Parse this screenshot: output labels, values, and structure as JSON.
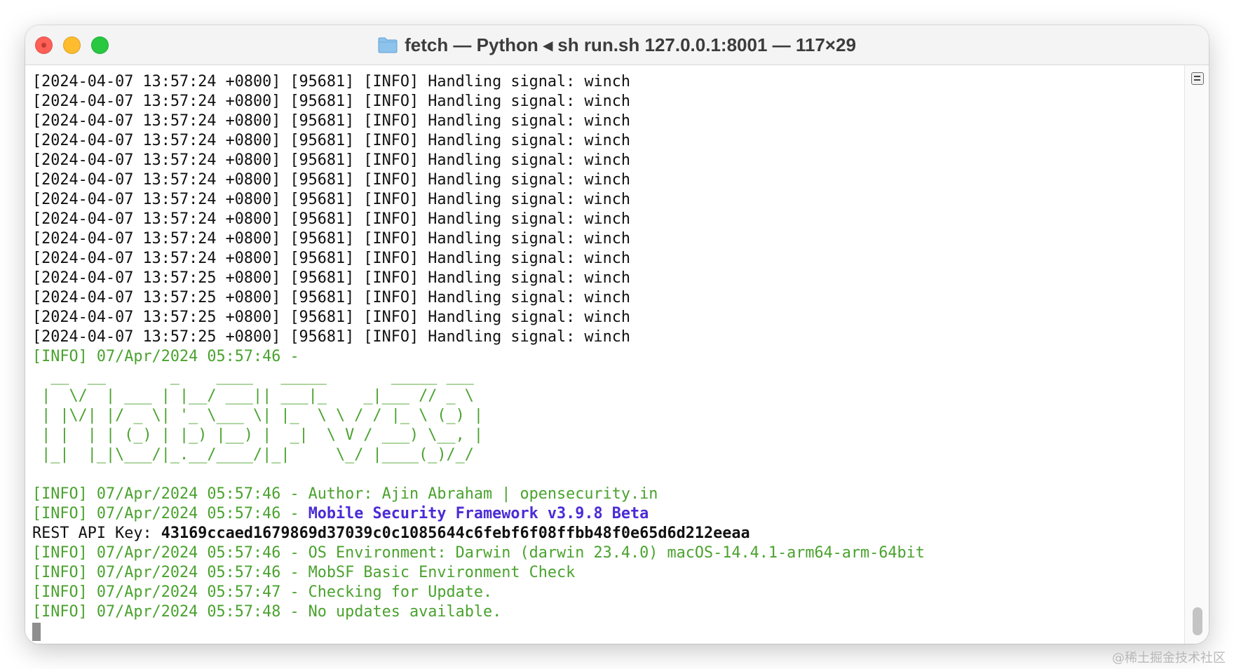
{
  "window": {
    "title": "fetch — Python ◂ sh run.sh 127.0.0.1:8001 — 117×29"
  },
  "log_lines": [
    "[2024-04-07 13:57:24 +0800] [95681] [INFO] Handling signal: winch",
    "[2024-04-07 13:57:24 +0800] [95681] [INFO] Handling signal: winch",
    "[2024-04-07 13:57:24 +0800] [95681] [INFO] Handling signal: winch",
    "[2024-04-07 13:57:24 +0800] [95681] [INFO] Handling signal: winch",
    "[2024-04-07 13:57:24 +0800] [95681] [INFO] Handling signal: winch",
    "[2024-04-07 13:57:24 +0800] [95681] [INFO] Handling signal: winch",
    "[2024-04-07 13:57:24 +0800] [95681] [INFO] Handling signal: winch",
    "[2024-04-07 13:57:24 +0800] [95681] [INFO] Handling signal: winch",
    "[2024-04-07 13:57:24 +0800] [95681] [INFO] Handling signal: winch",
    "[2024-04-07 13:57:24 +0800] [95681] [INFO] Handling signal: winch",
    "[2024-04-07 13:57:25 +0800] [95681] [INFO] Handling signal: winch",
    "[2024-04-07 13:57:25 +0800] [95681] [INFO] Handling signal: winch",
    "[2024-04-07 13:57:25 +0800] [95681] [INFO] Handling signal: winch",
    "[2024-04-07 13:57:25 +0800] [95681] [INFO] Handling signal: winch"
  ],
  "info_banner_line": "[INFO] 07/Apr/2024 05:57:46 -",
  "ascii_art": [
    "  __  __       _    ____   _____       _____ ___",
    " |  \\/  | ___ | |__/ ___|| ___|_    _|___ // _ \\",
    " | |\\/| |/ _ \\| '_ \\___ \\| |_  \\ \\ / / |_ \\ (_) |",
    " | |  | | (_) | |_) |__) |  _|  \\ V / ___) \\__, |",
    " |_|  |_|\\___/|_.__/____/|_|     \\_/ |____(_)/_/"
  ],
  "author_line": "[INFO] 07/Apr/2024 05:57:46 - Author: Ajin Abraham | opensecurity.in",
  "framework_line": {
    "prefix": "[INFO] 07/Apr/2024 05:57:46 - ",
    "name": "Mobile Security Framework v3.9.8 Beta"
  },
  "api_key_line": {
    "label": "REST API Key: ",
    "key": "43169ccaed1679869d37039c0c1085644c6febf6f08ffbb48f0e65d6d212eeaa"
  },
  "post_lines": [
    "[INFO] 07/Apr/2024 05:57:46 - OS Environment: Darwin (darwin 23.4.0) macOS-14.4.1-arm64-arm-64bit",
    "[INFO] 07/Apr/2024 05:57:46 - MobSF Basic Environment Check",
    "[INFO] 07/Apr/2024 05:57:47 - Checking for Update.",
    "[INFO] 07/Apr/2024 05:57:48 - No updates available."
  ],
  "watermark": "@稀土掘金技术社区",
  "colors": {
    "info_green": "#4aa22e",
    "framework_blue": "#4b2bd6",
    "close": "#ff5f57",
    "minimize": "#febc2e",
    "zoom": "#28c840"
  },
  "icons": {
    "title_icon": "folder-icon",
    "scrollbar_menu": "list-icon"
  }
}
